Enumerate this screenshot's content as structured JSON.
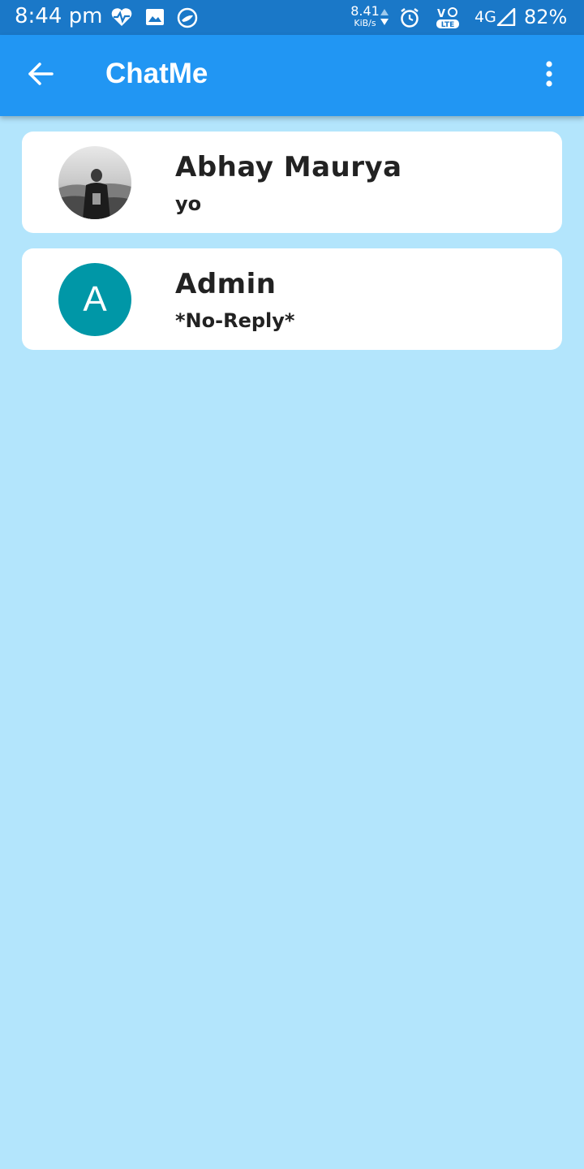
{
  "status_bar": {
    "time": "8:44 pm",
    "net_speed_value": "8.41",
    "net_speed_unit": "KiB/s",
    "network_label": "4G",
    "battery": "82%",
    "icons": [
      "heart-pulse-icon",
      "gallery-icon",
      "app-notification-icon",
      "data-arrows-icon",
      "alarm-icon",
      "volte-icon",
      "signal-icon"
    ]
  },
  "app_bar": {
    "title": "ChatMe",
    "color": "#2196f3",
    "back_icon": "arrow-back-icon",
    "menu_icon": "more-vert-icon"
  },
  "chats": [
    {
      "name": "Abhay Maurya",
      "last_message": "yo",
      "avatar": "photo"
    },
    {
      "name": "Admin",
      "last_message": "*No-Reply*",
      "avatar_letter": "A",
      "avatar_color": "#0097a7"
    }
  ],
  "background_color": "#b3e5fc"
}
